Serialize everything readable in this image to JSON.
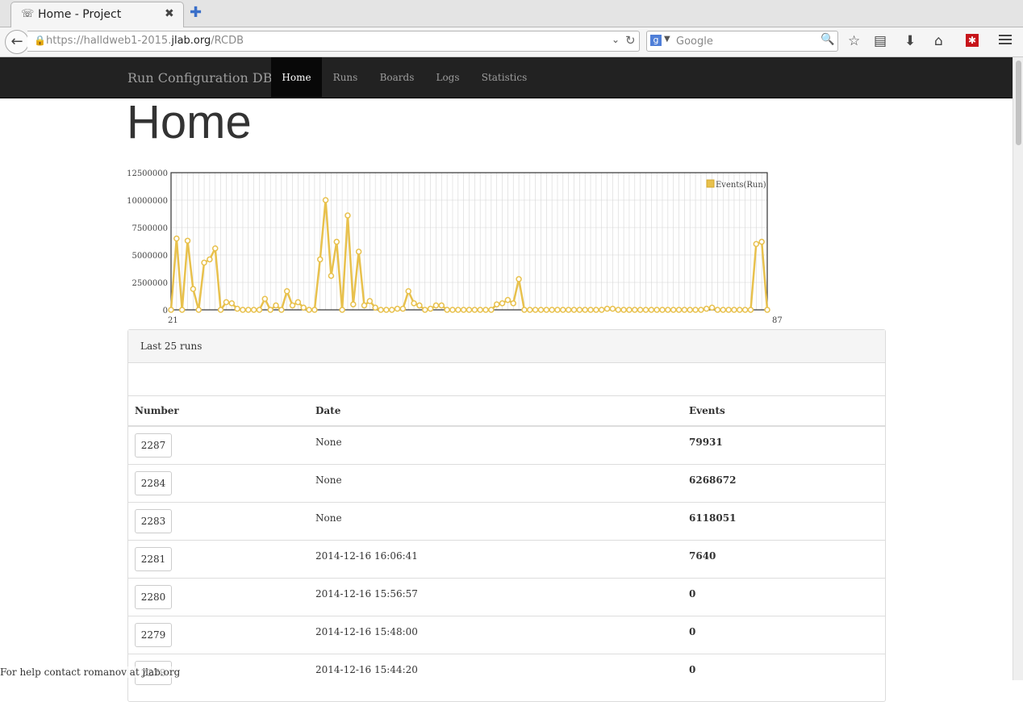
{
  "browser": {
    "tab_title": "Home - Project",
    "url_host_prefix": "https://halldweb1-2015.",
    "url_domain": "jlab.org",
    "url_path": "/RCDB",
    "search_placeholder": "Google",
    "search_engine_letter": "g"
  },
  "site": {
    "brand": "Run Configuration DB",
    "nav": [
      {
        "label": "Home",
        "active": true
      },
      {
        "label": "Runs",
        "active": false
      },
      {
        "label": "Boards",
        "active": false
      },
      {
        "label": "Logs",
        "active": false
      },
      {
        "label": "Statistics",
        "active": false
      }
    ]
  },
  "page_title": "Home",
  "chart_data": {
    "type": "line",
    "series": [
      {
        "name": "Events(Run)",
        "color": "#e8c14d"
      }
    ],
    "yticks": [
      "12500000",
      "10000000",
      "7500000",
      "5000000",
      "2500000",
      "0"
    ],
    "ylim": [
      0,
      12500000
    ],
    "x_first_label": "21",
    "x_last_label": "87",
    "values": [
      0,
      6500000,
      0,
      6300000,
      1900000,
      0,
      4300000,
      4600000,
      5600000,
      0,
      700000,
      600000,
      100000,
      0,
      0,
      0,
      0,
      1000000,
      0,
      400000,
      0,
      1700000,
      400000,
      700000,
      200000,
      0,
      0,
      4600000,
      10000000,
      3100000,
      6200000,
      0,
      8600000,
      500000,
      5300000,
      400000,
      800000,
      200000,
      0,
      0,
      0,
      100000,
      100000,
      1700000,
      600000,
      400000,
      0,
      100000,
      400000,
      400000,
      0,
      0,
      0,
      0,
      0,
      0,
      0,
      0,
      0,
      500000,
      600000,
      900000,
      600000,
      2800000,
      0,
      0,
      0,
      0,
      0,
      0,
      0,
      0,
      0,
      0,
      0,
      0,
      0,
      0,
      0,
      100000,
      100000,
      0,
      0,
      0,
      0,
      0,
      0,
      0,
      0,
      0,
      0,
      0,
      0,
      0,
      0,
      0,
      0,
      100000,
      200000,
      0,
      0,
      0,
      0,
      0,
      0,
      0,
      6000000,
      6200000,
      0
    ],
    "grid": true,
    "legend": "top-right"
  },
  "panel": {
    "title": "Last 25 runs",
    "headers": {
      "number": "Number",
      "date": "Date",
      "events": "Events"
    },
    "rows": [
      {
        "number": "2287",
        "date": "None",
        "events": "79931"
      },
      {
        "number": "2284",
        "date": "None",
        "events": "6268672"
      },
      {
        "number": "2283",
        "date": "None",
        "events": "6118051"
      },
      {
        "number": "2281",
        "date": "2014-12-16 16:06:41",
        "events": "7640"
      },
      {
        "number": "2280",
        "date": "2014-12-16 15:56:57",
        "events": "0"
      },
      {
        "number": "2279",
        "date": "2014-12-16 15:48:00",
        "events": "0"
      },
      {
        "number": "2278",
        "date": "2014-12-16 15:44:20",
        "events": "0"
      }
    ]
  },
  "footer": "For help contact romanov at jlab.org"
}
